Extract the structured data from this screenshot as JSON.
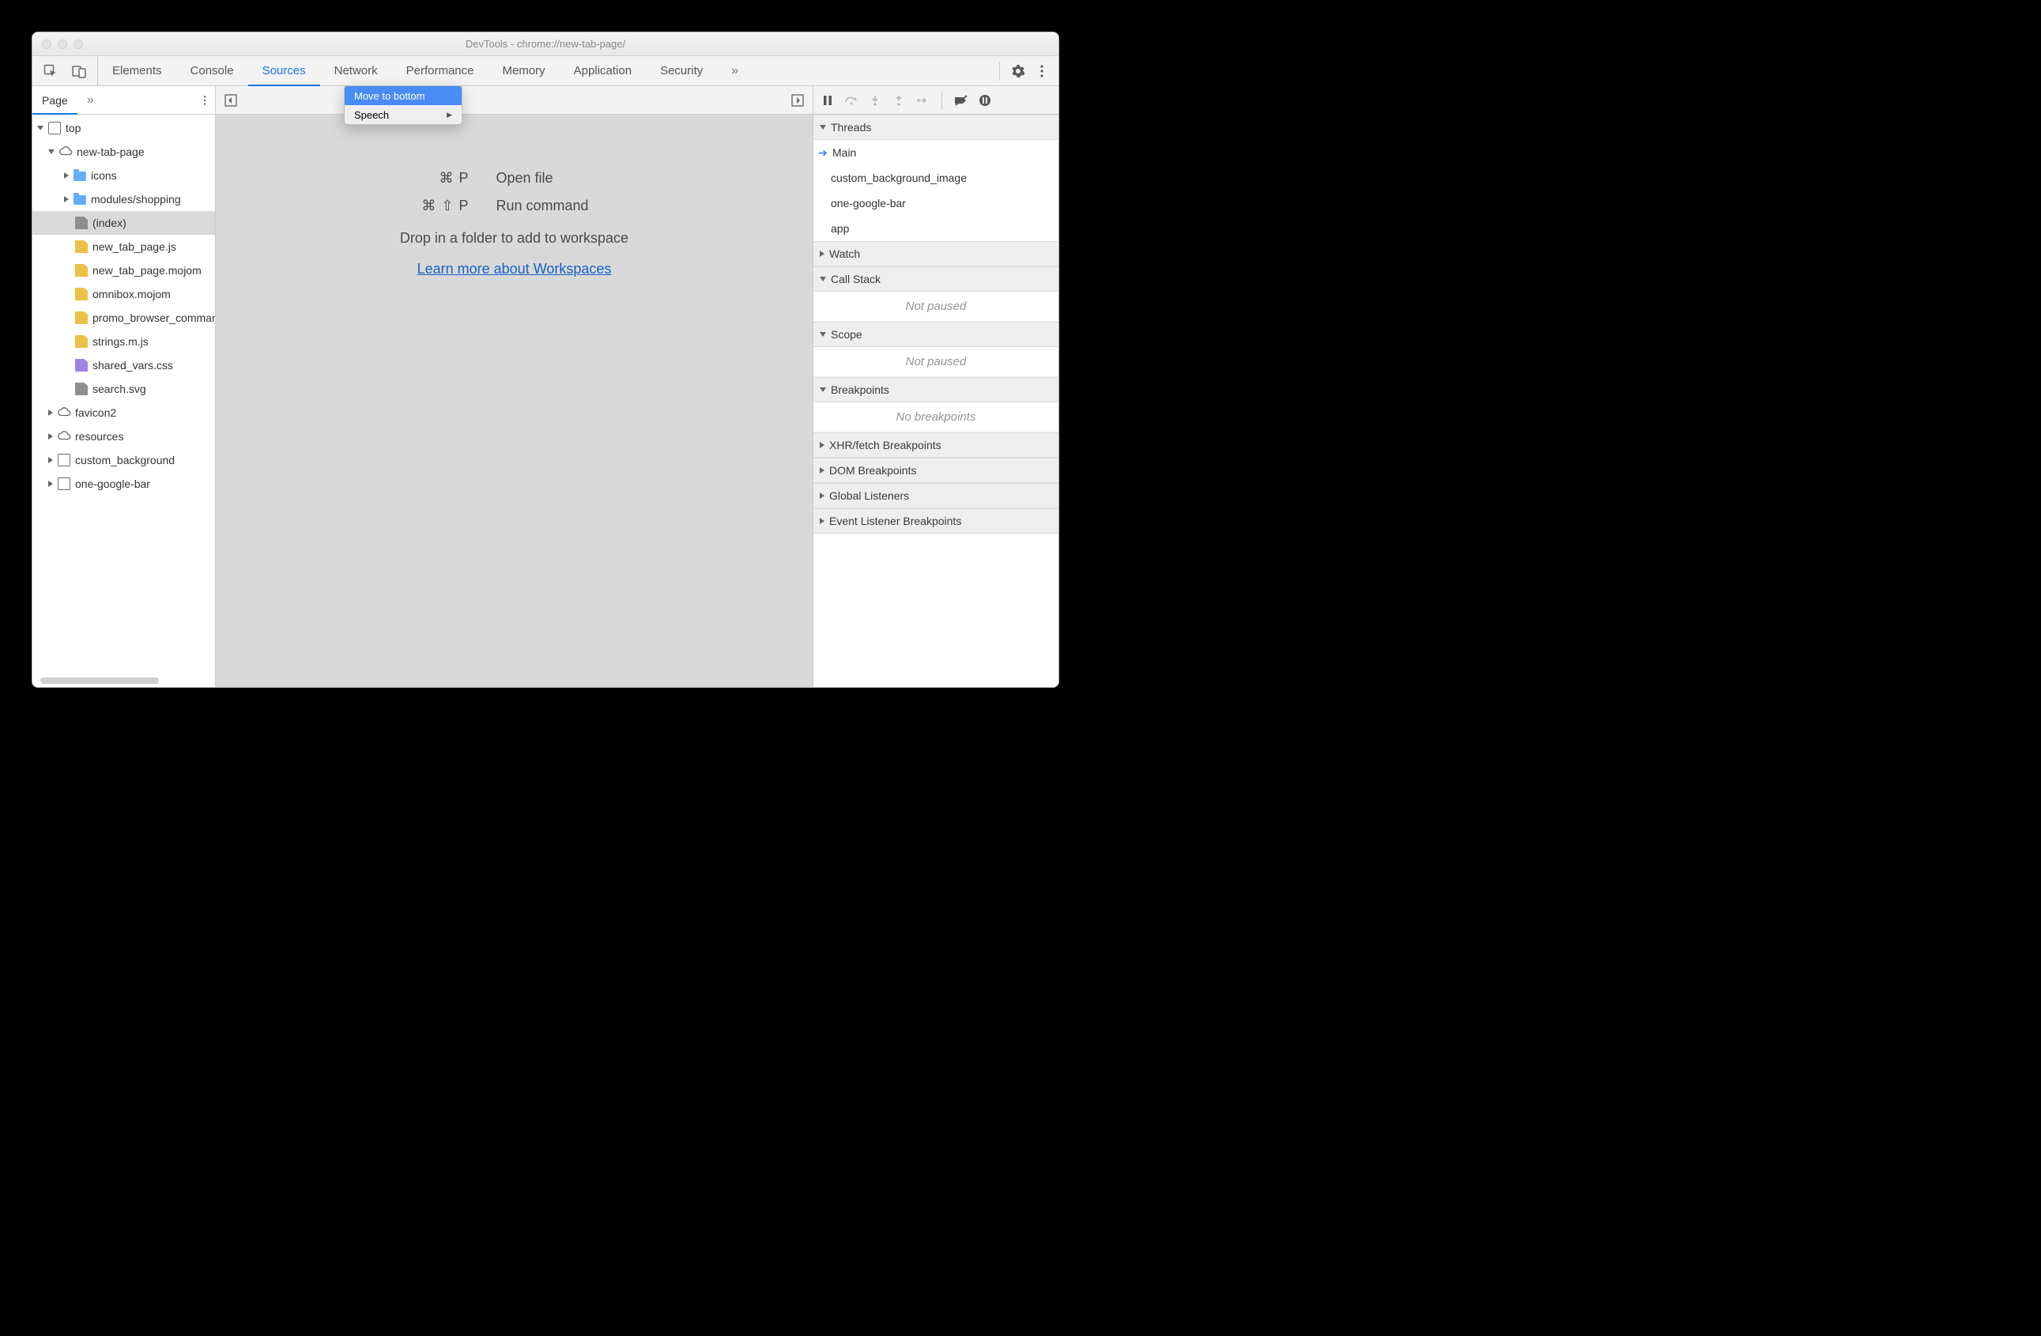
{
  "window_title": "DevTools - chrome://new-tab-page/",
  "tabs": [
    "Elements",
    "Console",
    "Sources",
    "Network",
    "Performance",
    "Memory",
    "Application",
    "Security"
  ],
  "active_tab": "Sources",
  "more_tabs_glyph": "»",
  "left": {
    "tab": "Page",
    "more": "»",
    "tree": {
      "top": "top",
      "ntp": "new-tab-page",
      "icons": "icons",
      "modules": "modules/shopping",
      "index": "(index)",
      "f1": "new_tab_page.js",
      "f2": "new_tab_page.mojom",
      "f3": "omnibox.mojom",
      "f4": "promo_browser_command",
      "f5": "strings.m.js",
      "f6": "shared_vars.css",
      "f7": "search.svg",
      "favicon2": "favicon2",
      "resources": "resources",
      "cbg": "custom_background",
      "ogb": "one-google-bar"
    }
  },
  "center": {
    "sc1_keys": "⌘ P",
    "sc1_label": "Open file",
    "sc2_keys": "⌘ ⇧ P",
    "sc2_label": "Run command",
    "drop": "Drop in a folder to add to workspace",
    "link": "Learn more about Workspaces"
  },
  "ctx": {
    "item1": "Move to bottom",
    "item2": "Speech",
    "arrow": "▶"
  },
  "right": {
    "threads_h": "Threads",
    "thread_main": "Main",
    "thread_cbg": "custom_background_image",
    "thread_ogb": "one-google-bar",
    "thread_app": "app",
    "watch_h": "Watch",
    "callstack_h": "Call Stack",
    "not_paused": "Not paused",
    "scope_h": "Scope",
    "bp_h": "Breakpoints",
    "no_bp": "No breakpoints",
    "xhr_h": "XHR/fetch Breakpoints",
    "dom_h": "DOM Breakpoints",
    "gl_h": "Global Listeners",
    "el_h": "Event Listener Breakpoints"
  }
}
